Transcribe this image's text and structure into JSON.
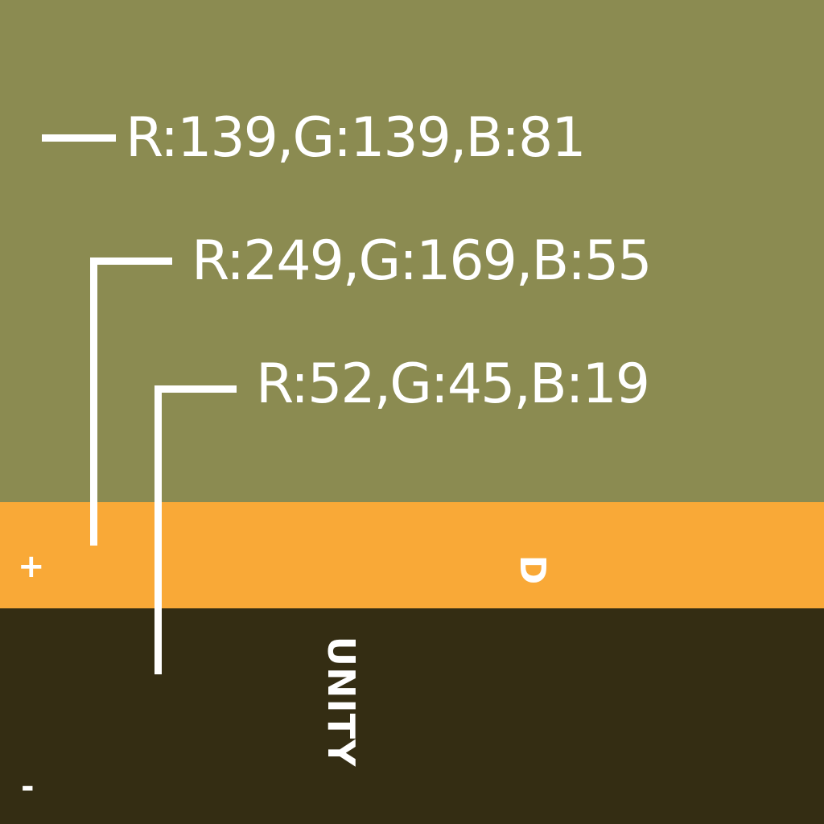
{
  "colors": {
    "swatch_top": "#8B8B51",
    "swatch_middle": "#F9A937",
    "swatch_bottom": "#342D13",
    "text": "#FFFFFF"
  },
  "labels": {
    "top": "R:139,G:139,B:81",
    "middle": "R:249,G:169,B:55",
    "bottom": "R:52,G:45,B:19"
  },
  "marks": {
    "plus": "+",
    "minus": "-",
    "d": "D",
    "unity": "UNITY"
  }
}
